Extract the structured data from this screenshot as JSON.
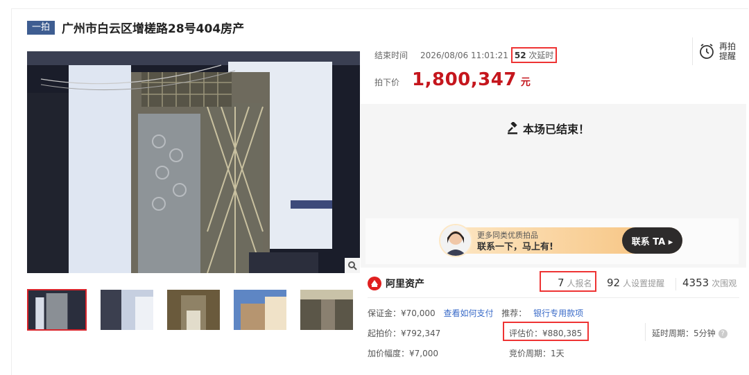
{
  "header": {
    "round_badge": "一拍",
    "title": "广州市白云区增槎路28号404房产"
  },
  "auction": {
    "end_label": "结束时间",
    "end_time": "2026/08/06 11:01:21",
    "delay_count": "52",
    "delay_suffix": "次延时",
    "final_label": "拍下价",
    "final_price": "1,800,347",
    "currency": "元",
    "remind_label": "再拍提醒",
    "ended_text": "本场已结束！"
  },
  "banner": {
    "line1": "更多同类优质拍品",
    "line2": "联系一下，马上有!",
    "cta": "联系 TA ▸"
  },
  "stats": {
    "brand": "阿里资产",
    "registrants": "7",
    "registrants_label": "人报名",
    "reminders": "92",
    "reminders_label": "人设置提醒",
    "views": "4353",
    "views_label": "次围观"
  },
  "details": {
    "deposit": "保证金：¥70,000",
    "how_to_pay": "查看如何支付",
    "recommend": "推荐：",
    "bank_payment": "银行专用款项",
    "start_price": "起拍价：¥792,347",
    "eval_price": "评估价：¥880,385",
    "delay_period": "延时周期：5分钟",
    "increment": "加价幅度：¥7,000",
    "bid_period": "竞价周期：1天"
  },
  "icons": {
    "zoom": "magnifier-icon",
    "remind": "alarm-clock-icon",
    "ended": "gavel-icon",
    "brand": "ali-asset-logo",
    "help": "question-icon"
  },
  "colors": {
    "price": "#c5161d",
    "badge": "#3e5d91",
    "highlight_box": "#e33",
    "link": "#3a6bc8"
  }
}
